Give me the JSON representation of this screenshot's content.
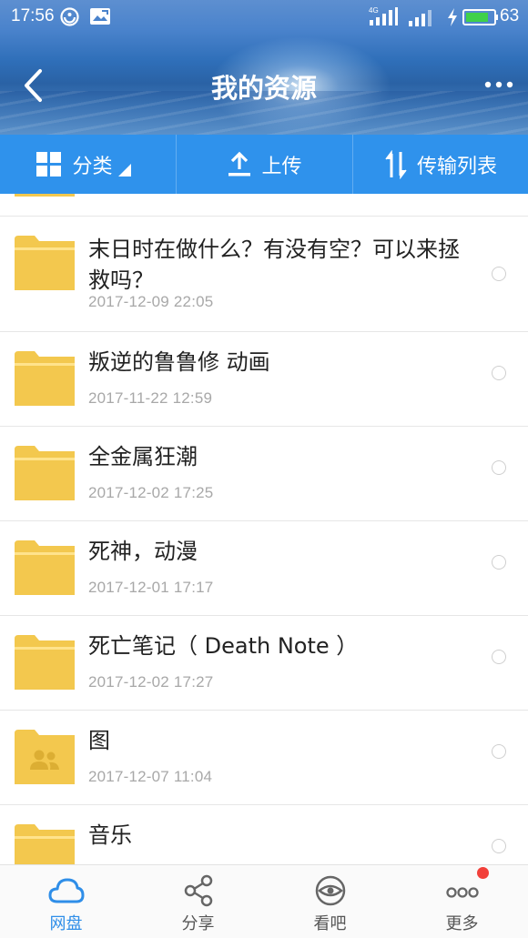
{
  "status_bar": {
    "time": "17:56",
    "network": "4G",
    "battery": "63"
  },
  "header": {
    "title": "我的资源"
  },
  "toolbar": {
    "category_label": "分类",
    "upload_label": "上传",
    "transfer_list_label": "传输列表"
  },
  "files": [
    {
      "name": "末日时在做什么？有没有空？可以来拯救吗？",
      "date": "2017-12-09  22:05",
      "icon": "folder-icon"
    },
    {
      "name": "叛逆的鲁鲁修 动画",
      "date": "2017-11-22  12:59",
      "icon": "folder-icon"
    },
    {
      "name": "全金属狂潮",
      "date": "2017-12-02  17:25",
      "icon": "folder-icon"
    },
    {
      "name": "死神，动漫",
      "date": "2017-12-01  17:17",
      "icon": "folder-icon"
    },
    {
      "name": "死亡笔记（ Death Note ）",
      "date": "2017-12-02  17:27",
      "icon": "folder-icon"
    },
    {
      "name": "图",
      "date": "2017-12-07  11:04",
      "icon": "shared-folder-icon"
    },
    {
      "name": "音乐",
      "date": "",
      "icon": "folder-icon"
    }
  ],
  "bottom_nav": {
    "items": [
      {
        "label": "网盘",
        "icon": "cloud-icon",
        "active": true
      },
      {
        "label": "分享",
        "icon": "share-icon",
        "active": false
      },
      {
        "label": "看吧",
        "icon": "eye-icon",
        "active": false
      },
      {
        "label": "更多",
        "icon": "more-icon",
        "active": false,
        "badge": true
      }
    ]
  },
  "colors": {
    "accent": "#2f92ec",
    "folder": "#f3c84e",
    "badge": "#f2403a"
  }
}
